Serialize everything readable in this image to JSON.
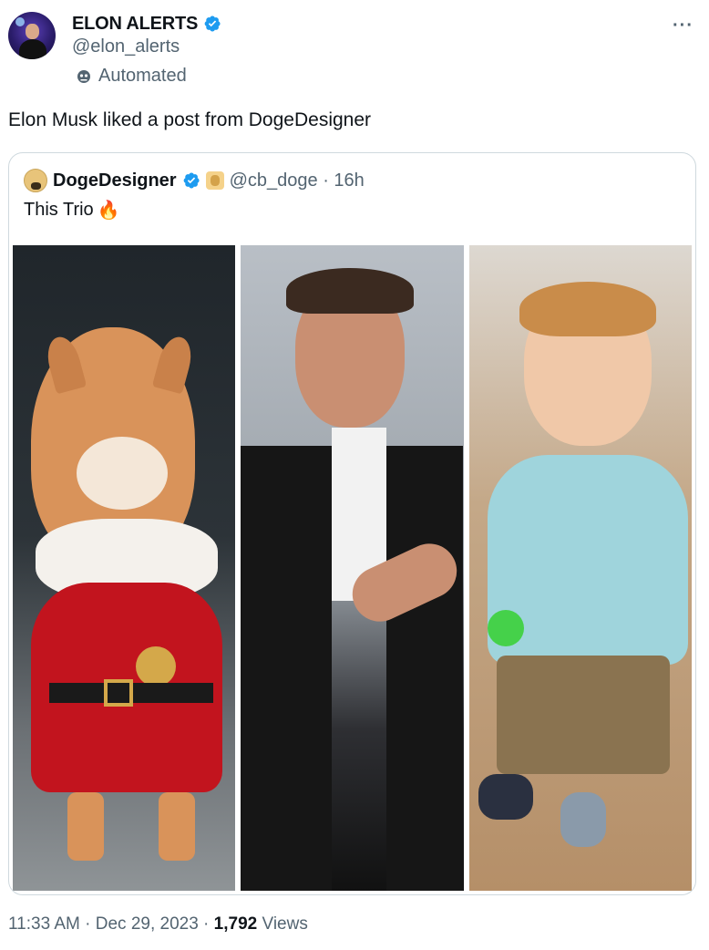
{
  "tweet": {
    "author": {
      "display_name": "ELON ALERTS",
      "handle": "@elon_alerts",
      "verified": true
    },
    "automated_label": "Automated",
    "more_icon": "more-horizontal-icon",
    "text": "Elon Musk liked a post from DogeDesigner",
    "timestamp": "11:33 AM · Dec 29, 2023 · ",
    "views_count": "1,792",
    "views_label": " Views"
  },
  "quoted": {
    "display_name": "DogeDesigner",
    "handle_meta": "@cb_doge · 16h",
    "text": "This Trio",
    "emoji": "fire-emoji"
  },
  "colors": {
    "verified_blue": "#1d9bf0",
    "secondary_text": "#536471",
    "border": "#cfd9de"
  }
}
